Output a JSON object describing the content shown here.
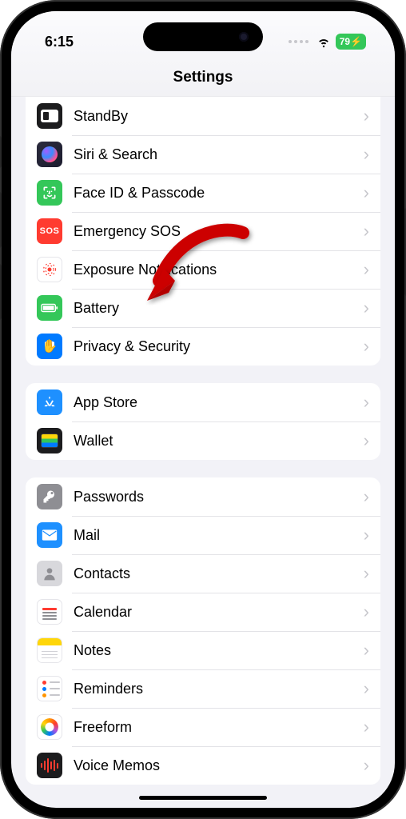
{
  "status": {
    "time": "6:15",
    "battery_level": "79",
    "battery_charging_glyph": "⚡"
  },
  "header": {
    "title": "Settings"
  },
  "groups": [
    {
      "id": "system",
      "items": [
        {
          "id": "standby",
          "label": "StandBy"
        },
        {
          "id": "siri",
          "label": "Siri & Search"
        },
        {
          "id": "faceid",
          "label": "Face ID & Passcode"
        },
        {
          "id": "sos",
          "label": "Emergency SOS"
        },
        {
          "id": "exposure",
          "label": "Exposure Notifications"
        },
        {
          "id": "battery",
          "label": "Battery"
        },
        {
          "id": "privacy",
          "label": "Privacy & Security"
        }
      ]
    },
    {
      "id": "store",
      "items": [
        {
          "id": "appstore",
          "label": "App Store"
        },
        {
          "id": "wallet",
          "label": "Wallet"
        }
      ]
    },
    {
      "id": "apps",
      "items": [
        {
          "id": "passwords",
          "label": "Passwords"
        },
        {
          "id": "mail",
          "label": "Mail"
        },
        {
          "id": "contacts",
          "label": "Contacts"
        },
        {
          "id": "calendar",
          "label": "Calendar"
        },
        {
          "id": "notes",
          "label": "Notes"
        },
        {
          "id": "reminders",
          "label": "Reminders"
        },
        {
          "id": "freeform",
          "label": "Freeform"
        },
        {
          "id": "voicememos",
          "label": "Voice Memos"
        }
      ]
    }
  ],
  "annotation": {
    "target_item_id": "battery",
    "type": "curved-arrow",
    "color": "#cc0000"
  }
}
